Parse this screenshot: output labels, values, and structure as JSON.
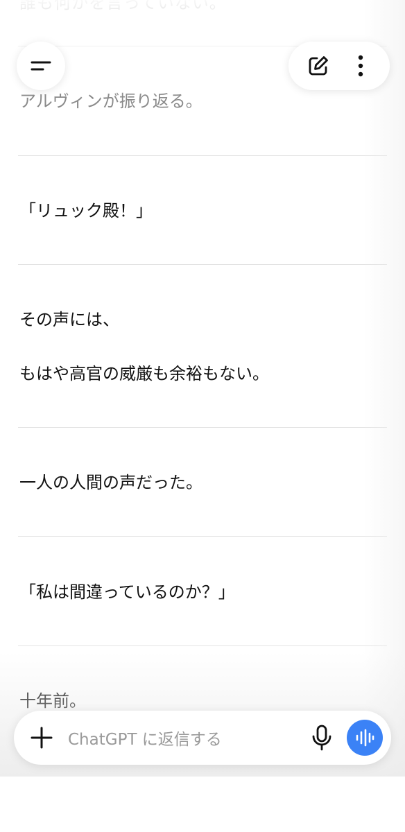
{
  "header": {
    "menu_icon": "menu-icon",
    "new_chat_icon": "edit-icon",
    "more_icon": "more-vertical-icon"
  },
  "messages": {
    "partial_top": "誰も何かを言っていない。",
    "p1": "アルヴィンが振り返る。",
    "p2": "「リュック殿！」",
    "p3a": "その声には、",
    "p3b": "もはや高官の威厳も余裕もない。",
    "p4": "一人の人間の声だった。",
    "p5": "「私は間違っているのか？」",
    "p6": "十年前。"
  },
  "composer": {
    "placeholder": "ChatGPT に返信する",
    "plus_icon": "plus-icon",
    "mic_icon": "mic-icon",
    "voice_icon": "voice-mode-icon"
  },
  "colors": {
    "accent": "#3b82f6",
    "text": "#111111",
    "muted": "#8a8a8a"
  }
}
